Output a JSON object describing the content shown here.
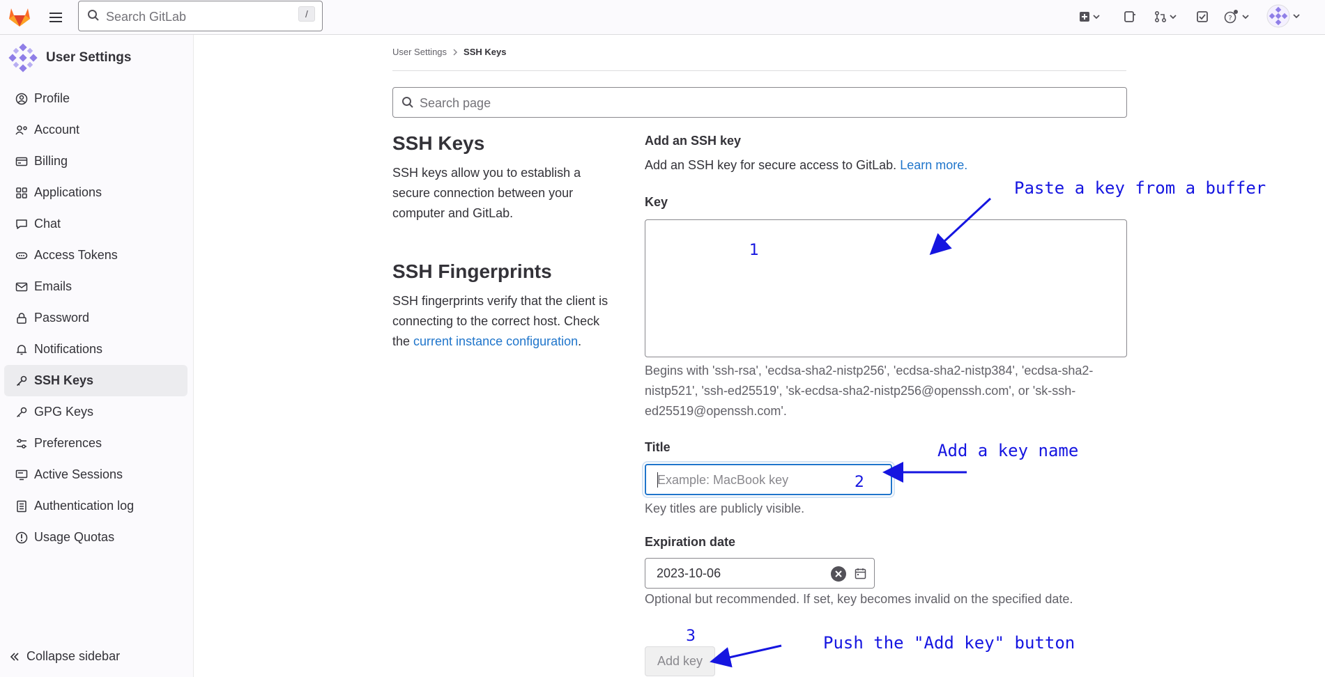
{
  "topbar": {
    "search_placeholder": "Search GitLab",
    "search_shortcut": "/"
  },
  "sidebar": {
    "title": "User Settings",
    "items": [
      {
        "label": "Profile",
        "icon": "profile-icon"
      },
      {
        "label": "Account",
        "icon": "account-icon"
      },
      {
        "label": "Billing",
        "icon": "billing-icon"
      },
      {
        "label": "Applications",
        "icon": "applications-icon"
      },
      {
        "label": "Chat",
        "icon": "chat-icon"
      },
      {
        "label": "Access Tokens",
        "icon": "token-icon"
      },
      {
        "label": "Emails",
        "icon": "mail-icon"
      },
      {
        "label": "Password",
        "icon": "lock-icon"
      },
      {
        "label": "Notifications",
        "icon": "bell-icon"
      },
      {
        "label": "SSH Keys",
        "icon": "key-icon",
        "active": true
      },
      {
        "label": "GPG Keys",
        "icon": "key-icon"
      },
      {
        "label": "Preferences",
        "icon": "preferences-icon"
      },
      {
        "label": "Active Sessions",
        "icon": "monitor-icon"
      },
      {
        "label": "Authentication log",
        "icon": "log-icon"
      },
      {
        "label": "Usage Quotas",
        "icon": "quota-icon"
      }
    ],
    "collapse_label": "Collapse sidebar"
  },
  "breadcrumb": {
    "parent": "User Settings",
    "current": "SSH Keys"
  },
  "page_search": {
    "placeholder": "Search page"
  },
  "left": {
    "ssh_title": "SSH Keys",
    "ssh_desc": "SSH keys allow you to establish a secure connection between your computer and GitLab.",
    "fp_title": "SSH Fingerprints",
    "fp_desc_before": "SSH fingerprints verify that the client is connecting to the correct host. Check the ",
    "fp_link": "current instance configuration",
    "fp_desc_after": "."
  },
  "form": {
    "heading": "Add an SSH key",
    "intro": "Add an SSH key for secure access to GitLab.",
    "learn_more": "Learn more.",
    "key_label": "Key",
    "key_value": "",
    "key_help": "Begins with 'ssh-rsa', 'ecdsa-sha2-nistp256', 'ecdsa-sha2-nistp384', 'ecdsa-sha2-nistp521', 'ssh-ed25519', 'sk-ecdsa-sha2-nistp256@openssh.com', or 'sk-ssh-ed25519@openssh.com'.",
    "title_label": "Title",
    "title_placeholder": "Example: MacBook key",
    "title_help": "Key titles are publicly visible.",
    "expiry_label": "Expiration date",
    "expiry_value": "2023-10-06",
    "expiry_help": "Optional but recommended. If set, key becomes invalid on the specified date.",
    "add_button": "Add key"
  },
  "annotations": {
    "step1": "1",
    "step2": "2",
    "step3": "3",
    "note1": "Paste a key from a buffer",
    "note2": "Add a key name",
    "note3": "Push the \"Add key\" button",
    "color": "#1515e0"
  },
  "colors": {
    "link": "#1f75cb",
    "focus": "#1f75cb",
    "sidebar_bg": "#fbfafd",
    "active_item_bg": "#ececef"
  }
}
